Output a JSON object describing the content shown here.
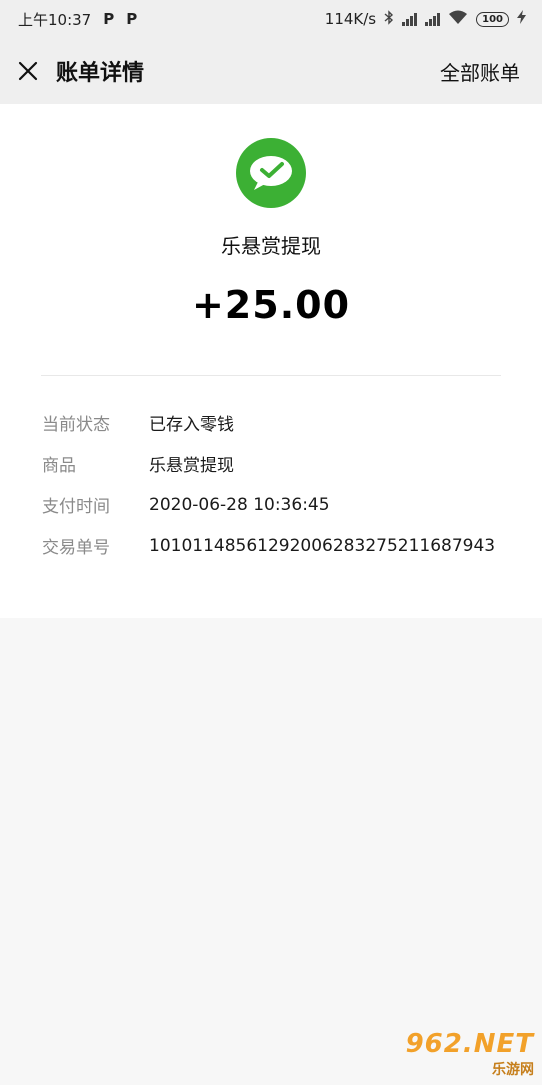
{
  "status_bar": {
    "time": "上午10:37",
    "speed": "114K/s",
    "battery": "100",
    "app_badges": [
      "P",
      "P"
    ]
  },
  "nav": {
    "title": "账单详情",
    "all_bills": "全部账单"
  },
  "transaction": {
    "merchant": "乐悬赏提现",
    "amount": "+25.00",
    "logo_color": "#3cb034"
  },
  "details": [
    {
      "label": "当前状态",
      "value": "已存入零钱"
    },
    {
      "label": "商品",
      "value": "乐悬赏提现"
    },
    {
      "label": "支付时间",
      "value": "2020-06-28 10:36:45"
    },
    {
      "label": "交易单号",
      "value": "10101148561292006283275211687943"
    }
  ],
  "watermark": {
    "top": "962.NET",
    "bottom": "乐游网"
  }
}
